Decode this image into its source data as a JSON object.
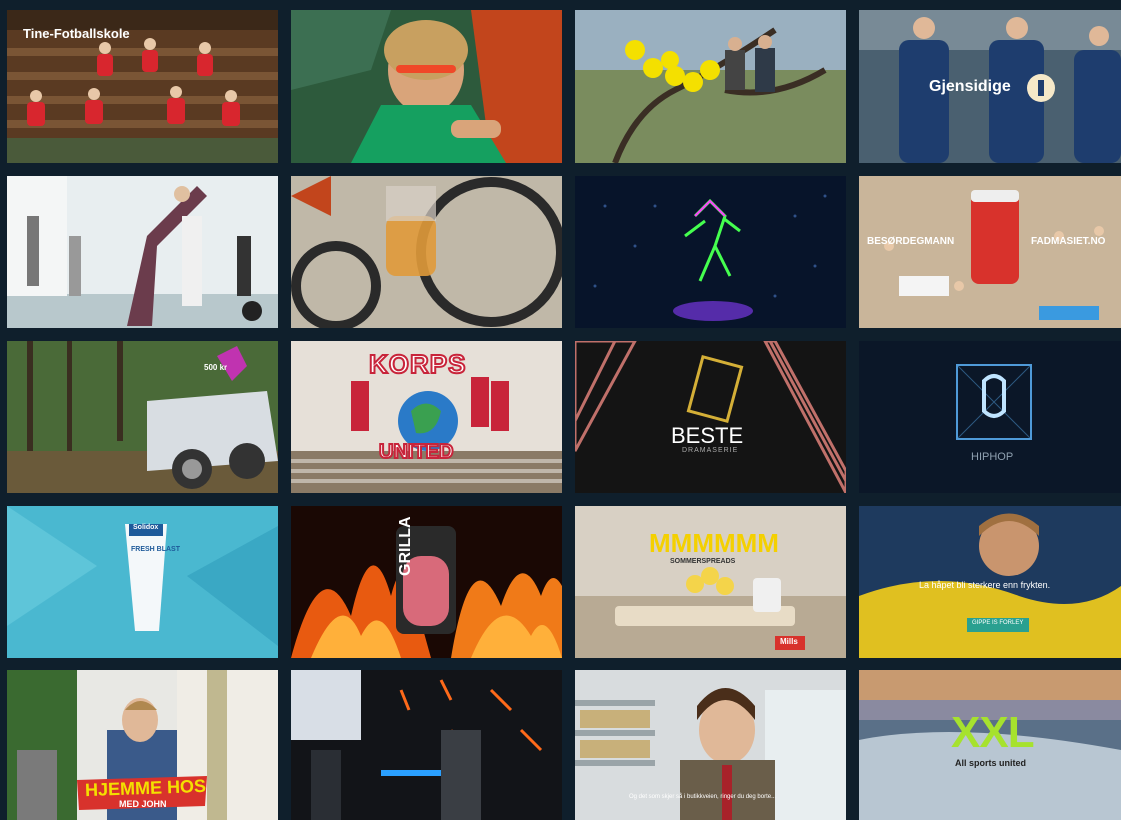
{
  "tiles": [
    {
      "id": "tine",
      "label": "Tine-Fotballskole"
    },
    {
      "id": "green-driver"
    },
    {
      "id": "balloons-tree"
    },
    {
      "id": "gjensidige",
      "label": "Gjensidige"
    },
    {
      "id": "yoga"
    },
    {
      "id": "wheelchair"
    },
    {
      "id": "neon-dancer"
    },
    {
      "id": "impregnert",
      "label_left": "BESØRDEGMANN",
      "label_right": "FADMASIET.NO"
    },
    {
      "id": "forest-car",
      "badge": "500 kr"
    },
    {
      "id": "korps",
      "label_top": "KORPS",
      "label_bottom": "UNITED"
    },
    {
      "id": "beste",
      "title": "BESTE",
      "subtitle": "DRAMASERIE"
    },
    {
      "id": "hiphop",
      "label": "HIPHOP"
    },
    {
      "id": "toothpaste",
      "brand": "Solidox",
      "product": "FRESH BLAST"
    },
    {
      "id": "grilla",
      "product": "GRILLA"
    },
    {
      "id": "mmmmm",
      "title": "MMMMMM",
      "subtitle": "SOMMERSPREADS",
      "logo": "Mills"
    },
    {
      "id": "hope",
      "caption": "La håpet bli sterkere enn frykten.",
      "button": "GIPPE IS FORLEY"
    },
    {
      "id": "hjemme-hos",
      "label_top": "HJEMME HOS",
      "label_bottom": "MED JOHN"
    },
    {
      "id": "gaming"
    },
    {
      "id": "store-man",
      "caption": "Og det som skjer så i butikkveien, ringer du deg borte..."
    },
    {
      "id": "xxl",
      "logo": "XXL",
      "tagline": "All sports united"
    }
  ],
  "colors": {
    "background": "#0f1f2c",
    "xxl_green": "#a6e22e",
    "gjensidige_blue": "#1e3d6e"
  }
}
